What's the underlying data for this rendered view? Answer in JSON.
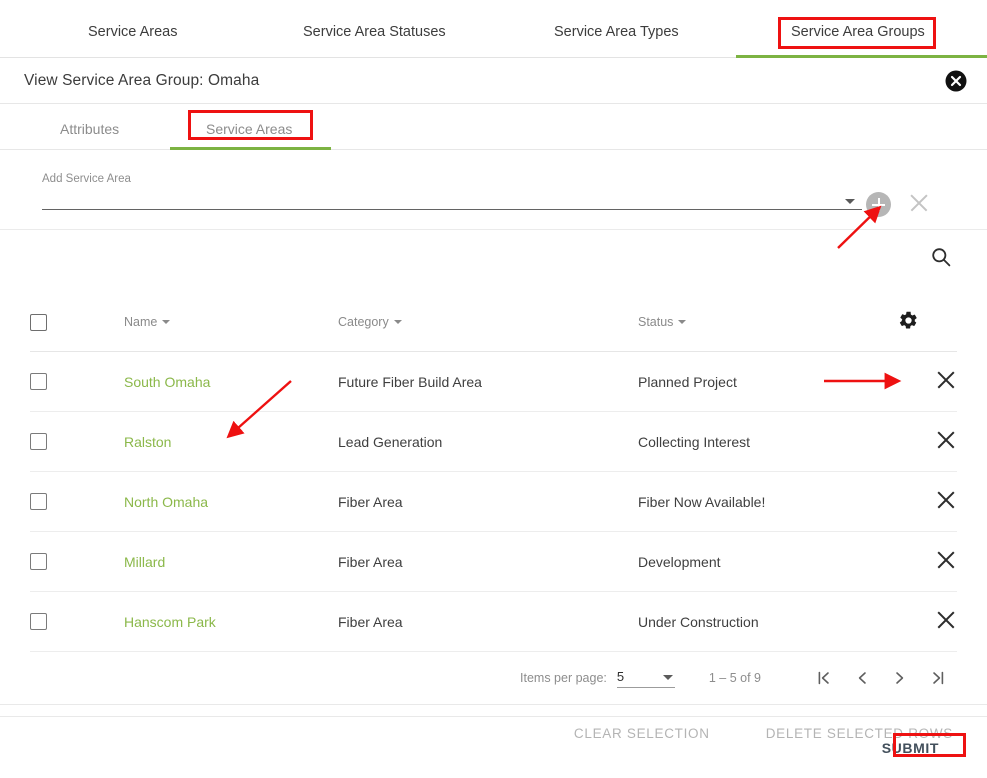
{
  "topnav": {
    "tabs": [
      {
        "label": "Service Areas",
        "active": false
      },
      {
        "label": "Service Area Statuses",
        "active": false
      },
      {
        "label": "Service Area Types",
        "active": false
      },
      {
        "label": "Service Area Groups",
        "active": true
      }
    ],
    "accent_color": "#7cb342"
  },
  "header": {
    "title": "View Service Area Group: Omaha",
    "close_icon": "close-circle-icon"
  },
  "subnav": {
    "tabs": [
      {
        "label": "Attributes",
        "active": false
      },
      {
        "label": "Service Areas",
        "active": true
      }
    ]
  },
  "add_service_area": {
    "label": "Add Service Area",
    "value": "",
    "dropdown_icon": "chevron-down-icon",
    "add_icon": "plus-circle-icon",
    "clear_icon": "close-icon"
  },
  "toolbar": {
    "search_icon": "search-icon",
    "settings_icon": "gear-icon"
  },
  "table": {
    "columns": [
      {
        "label": "",
        "name": "select"
      },
      {
        "label": "Name",
        "name": "name",
        "sortable": true
      },
      {
        "label": "Category",
        "name": "category",
        "sortable": true
      },
      {
        "label": "Status",
        "name": "status",
        "sortable": true
      },
      {
        "label": "",
        "name": "actions"
      }
    ],
    "rows": [
      {
        "name": "South Omaha",
        "category": "Future Fiber Build Area",
        "status": "Planned Project",
        "selected": false
      },
      {
        "name": "Ralston",
        "category": "Lead Generation",
        "status": "Collecting Interest",
        "selected": false
      },
      {
        "name": "North Omaha",
        "category": "Fiber Area",
        "status": "Fiber Now Available!",
        "selected": false
      },
      {
        "name": "Millard",
        "category": "Fiber Area",
        "status": "Development",
        "selected": false
      },
      {
        "name": "Hanscom Park",
        "category": "Fiber Area",
        "status": "Under Construction",
        "selected": false
      }
    ],
    "link_color": "#8bb84a",
    "delete_row_icon": "close-icon"
  },
  "paginator": {
    "items_per_page_label": "Items per page:",
    "items_per_page_value": "5",
    "range_label": "1 – 5 of 9",
    "first_page_icon": "first-page-icon",
    "prev_page_icon": "chevron-left-icon",
    "next_page_icon": "chevron-right-icon",
    "last_page_icon": "last-page-icon"
  },
  "bulk_actions": {
    "clear_selection": "CLEAR SELECTION",
    "delete_selected_rows": "DELETE SELECTED ROWS"
  },
  "footer": {
    "submit_label": "SUBMIT"
  },
  "annotations": {
    "highlight_color": "#ee1111",
    "boxes": [
      {
        "name": "service-area-groups-tab"
      },
      {
        "name": "service-areas-subtab"
      },
      {
        "name": "submit-button"
      }
    ],
    "arrows": [
      {
        "name": "arrow-to-add-button"
      },
      {
        "name": "arrow-to-row-name"
      },
      {
        "name": "arrow-to-delete-row"
      }
    ]
  }
}
